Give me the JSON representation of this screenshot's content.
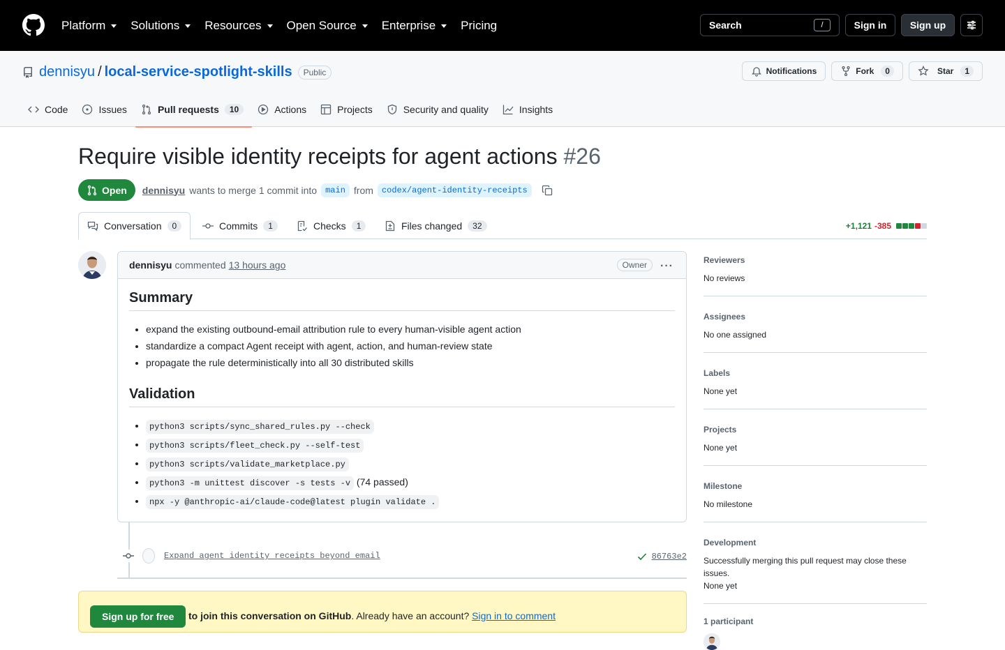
{
  "header": {
    "nav": [
      "Platform",
      "Solutions",
      "Resources",
      "Open Source",
      "Enterprise",
      "Pricing"
    ],
    "search_label": "Search",
    "search_key": "/",
    "signin": "Sign in",
    "signup": "Sign up"
  },
  "repo": {
    "owner": "dennisyu",
    "separator": "/",
    "name": "local-service-spotlight-skills",
    "visibility": "Public",
    "notifications": "Notifications",
    "fork_label": "Fork",
    "fork_count": "0",
    "star_label": "Star",
    "star_count": "1",
    "tabs": [
      {
        "label": "Code"
      },
      {
        "label": "Issues"
      },
      {
        "label": "Pull requests",
        "count": "10"
      },
      {
        "label": "Actions"
      },
      {
        "label": "Projects"
      },
      {
        "label": "Security and quality"
      },
      {
        "label": "Insights"
      }
    ]
  },
  "pr": {
    "title": "Require visible identity receipts for agent actions",
    "number": "#26",
    "state": "Open",
    "author": "dennisyu",
    "merge_text": "wants to merge 1 commit into",
    "base": "main",
    "from": "from",
    "head": "codex/agent-identity-receipts",
    "tabs": [
      {
        "label": "Conversation",
        "count": "0"
      },
      {
        "label": "Commits",
        "count": "1"
      },
      {
        "label": "Checks",
        "count": "1"
      },
      {
        "label": "Files changed",
        "count": "32"
      }
    ],
    "additions": "+1,121",
    "deletions": "-385",
    "diffstat_boxes": [
      "add",
      "add",
      "add",
      "del",
      "neutral"
    ]
  },
  "comment": {
    "author": "dennisyu",
    "action": "commented",
    "time": "13 hours ago",
    "badge": "Owner",
    "menu": "···",
    "summary_heading": "Summary",
    "summary_items": [
      "expand the existing outbound-email attribution rule to every human-visible agent action",
      "standardize a compact Agent receipt with agent, action, and human-review state",
      "propagate the rule deterministically into all 30 distributed skills"
    ],
    "validation_heading": "Validation",
    "validation_items": [
      {
        "code": "python3 scripts/sync_shared_rules.py --check",
        "suffix": ""
      },
      {
        "code": "python3 scripts/fleet_check.py --self-test",
        "suffix": ""
      },
      {
        "code": "python3 scripts/validate_marketplace.py",
        "suffix": ""
      },
      {
        "code": "python3 -m unittest discover -s tests -v",
        "suffix": " (74 passed)"
      },
      {
        "code": "npx -y @anthropic-ai/claude-code@latest plugin validate .",
        "suffix": ""
      }
    ]
  },
  "commit": {
    "message": "Expand agent identity receipts beyond email",
    "sha": "86763e2"
  },
  "banner": {
    "button": "Sign up for free",
    "text_bold": "to join this conversation on GitHub",
    "text_mid": ". Already have an account? ",
    "link": "Sign in to comment"
  },
  "sidebar": {
    "sections": [
      {
        "title": "Reviewers",
        "value": "No reviews"
      },
      {
        "title": "Assignees",
        "value": "No one assigned"
      },
      {
        "title": "Labels",
        "value": "None yet"
      },
      {
        "title": "Projects",
        "value": "None yet"
      },
      {
        "title": "Milestone",
        "value": "No milestone"
      }
    ],
    "development_title": "Development",
    "development_text": "Successfully merging this pull request may close these issues.",
    "development_value": "None yet",
    "participants_title": "1 participant"
  },
  "colors": {
    "accent": "#0969da",
    "open_green": "#1f883d",
    "tab_underline": "#fd8c73",
    "banner_bg": "#fff8c5"
  }
}
